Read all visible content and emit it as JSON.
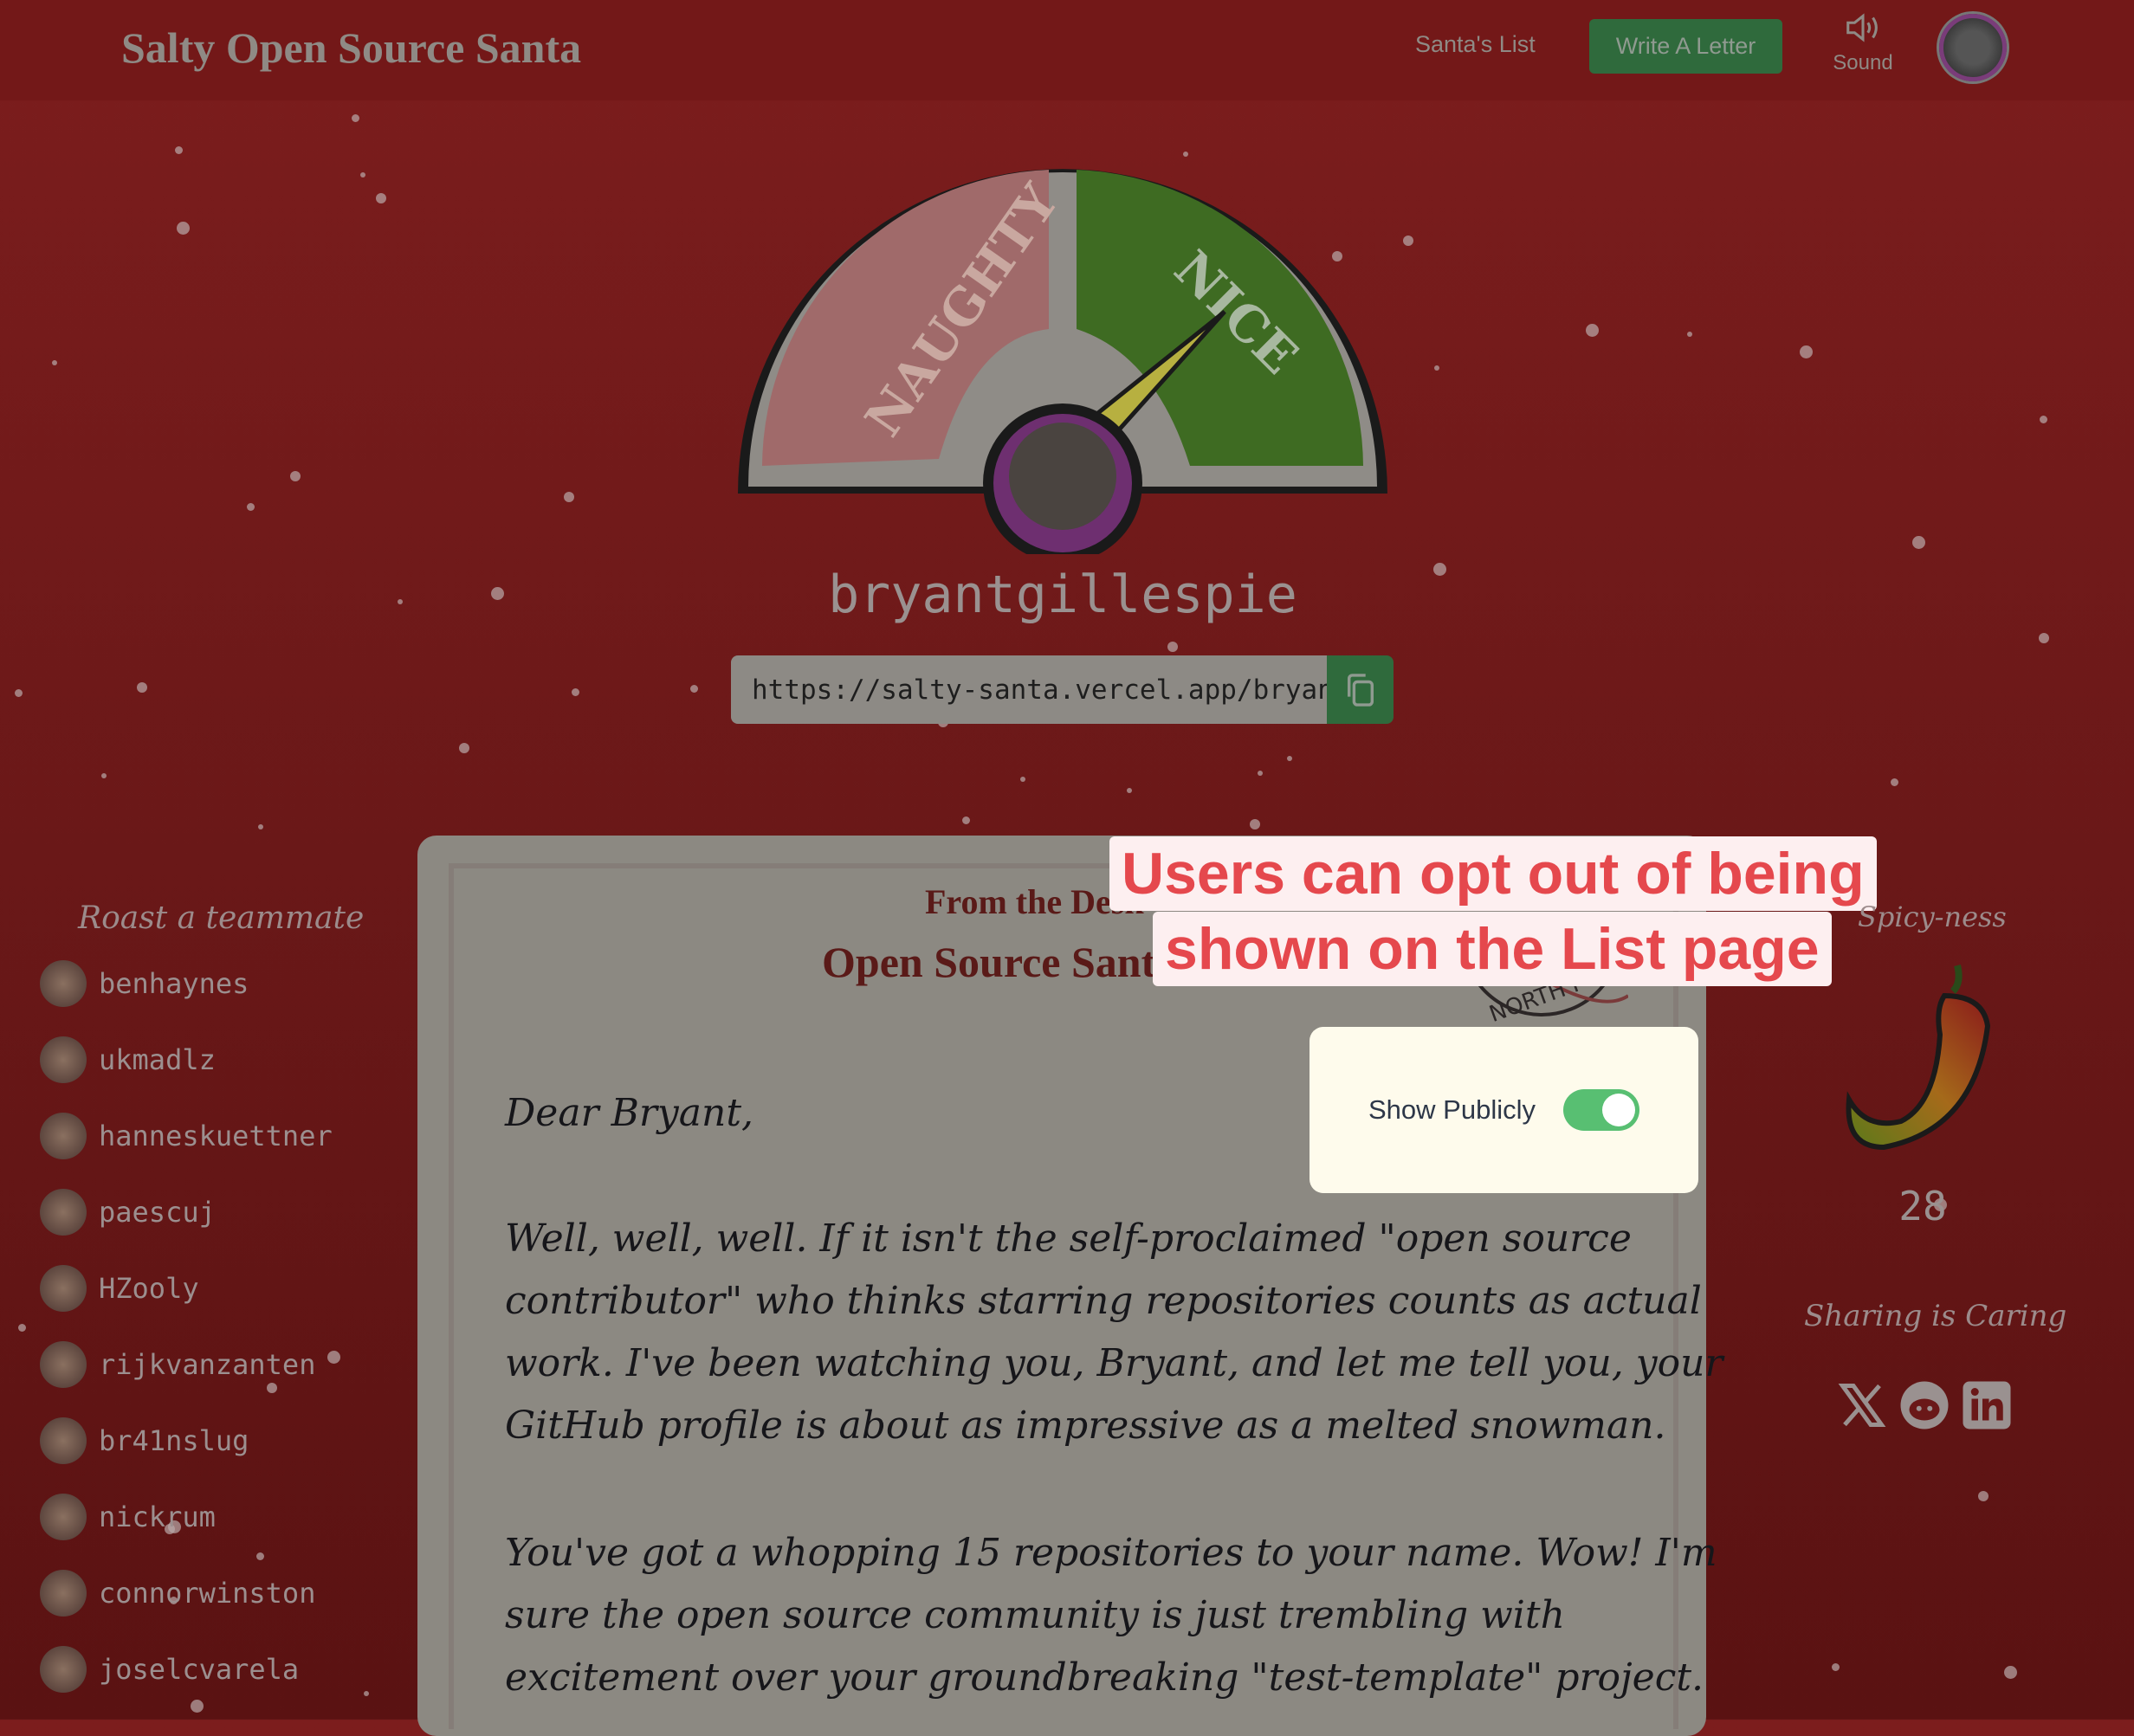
{
  "header": {
    "title": "Salty Open Source Santa",
    "nav_list": "Santa's List",
    "write_letter": "Write A Letter",
    "sound_label": "Sound",
    "sound_icon": "speaker-icon"
  },
  "gauge": {
    "left_label": "NAUGHTY",
    "right_label": "NICE",
    "needle_icon": "gauge-needle"
  },
  "profile": {
    "username": "bryantgillespie",
    "share_url": "https://salty-santa.vercel.app/bryantgillespie",
    "copy_icon": "copy-icon"
  },
  "sidebar": {
    "heading": "Roast a teammate",
    "teammates": [
      "benhaynes",
      "ukmadlz",
      "hanneskuettner",
      "paescuj",
      "HZooly",
      "rijkvanzanten",
      "br41nslug",
      "nickrum",
      "connorwinston",
      "joselcvarela"
    ]
  },
  "letter": {
    "from_line": "From the Desk",
    "title_line": "Open Source Santa",
    "stamp_text": "NORTH POLE",
    "greeting": "Dear Bryant,",
    "paragraph1": [
      "Well, well, well. If it isn't the self-proclaimed \"open source",
      "contributor\" who thinks starring repositories counts as actual",
      "work. I've been watching you, Bryant, and let me tell you, your",
      "GitHub profile is about as impressive as a melted snowman."
    ],
    "paragraph2": [
      "You've got a whopping 15 repositories to your name. Wow! I'm",
      "sure the open source community is just trembling with",
      "excitement over your groundbreaking \"test-template\" project."
    ]
  },
  "annotation": {
    "line1": "Users can opt out of being",
    "line2": "shown on the List page"
  },
  "visibility": {
    "label": "Show Publicly",
    "enabled": true
  },
  "spice": {
    "heading": "Spicy-ness",
    "score": "28",
    "icon": "chili-pepper-icon"
  },
  "share": {
    "heading": "Sharing is Caring",
    "icons": [
      "x-icon",
      "reddit-icon",
      "linkedin-icon"
    ]
  },
  "colors": {
    "background": "#7c1d1d",
    "accent_green": "#2f6a3c",
    "annotation_red": "#e5484d",
    "toggle_on": "#58bf72"
  }
}
